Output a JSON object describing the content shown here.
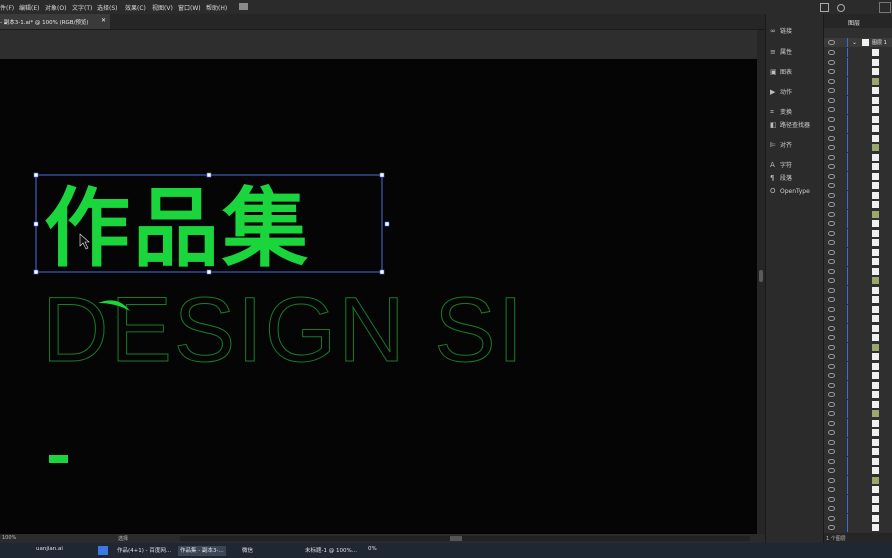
{
  "menu": [
    "件(F)",
    "编辑(E)",
    "对象(O)",
    "文字(T)",
    "选择(S)",
    "效果(C)",
    "视图(V)",
    "窗口(W)",
    "帮助(H)"
  ],
  "document_tab": "- 副本3-1.ai* @ 100% (RGB/预览)",
  "artwork": {
    "title_cn": "作品集",
    "outline_text": "DESIGN SI"
  },
  "props_panel": {
    "items": [
      {
        "icon": "link-icon",
        "label": "链接"
      },
      {
        "icon": "properties-icon",
        "label": "属性"
      },
      {
        "icon": "libraries-icon",
        "label": "图表"
      },
      {
        "icon": "actions-icon",
        "label": "动作"
      },
      {
        "icon": "transform-icon",
        "label": "变换"
      },
      {
        "icon": "pathfinder-icon",
        "label": "路径查找器"
      },
      {
        "icon": "align-icon",
        "label": "对齐"
      },
      {
        "icon": "character-icon",
        "label": "字符"
      },
      {
        "icon": "paragraph-icon",
        "label": "段落"
      },
      {
        "icon": "opentype-icon",
        "label": "OpenType"
      }
    ]
  },
  "layers_panel": {
    "tab_label": "图层",
    "top_layer": "图层 1",
    "footer": "1 个图层"
  },
  "status": {
    "zoom": "100%",
    "tool": "选择"
  },
  "taskbar": [
    "uanjian.ai",
    "作品(4+1) - 百度网...",
    "作品集 - 副本3-...",
    "微信",
    "未标题-1 @ 100%...",
    "0%"
  ],
  "colors": {
    "accent": "#1ad63c",
    "selection": "#4a6bdc"
  }
}
